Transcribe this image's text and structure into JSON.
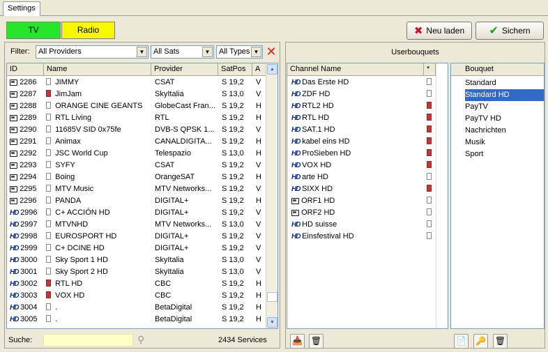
{
  "tabs": [
    {
      "label": "Settings"
    }
  ],
  "mode": {
    "tv_label": "TV",
    "radio_label": "Radio",
    "tv_color": "#27e627",
    "radio_color": "#f7f700"
  },
  "actions": {
    "reload_label": "Neu laden",
    "save_label": "Sichern"
  },
  "filter": {
    "label": "Filter:",
    "providers": "All Providers",
    "sats": "All Sats",
    "types": "All Types"
  },
  "services": {
    "columns": [
      "ID",
      "Name",
      "Provider",
      "SatPos",
      "A"
    ],
    "rows": [
      {
        "icon": "tv",
        "doc": "white",
        "id": "2286",
        "name": "JIMMY",
        "provider": "CSAT",
        "satpos": "S 19,2",
        "a": "V"
      },
      {
        "icon": "tv",
        "doc": "red",
        "id": "2287",
        "name": "JimJam",
        "provider": "SkyItalia",
        "satpos": "S 13,0",
        "a": "V"
      },
      {
        "icon": "tv",
        "doc": "white",
        "id": "2288",
        "name": "ORANGE CINE GEANTS",
        "provider": "GlobeCast Fran...",
        "satpos": "S 19,2",
        "a": "H"
      },
      {
        "icon": "tv",
        "doc": "white",
        "id": "2289",
        "name": "RTL Living",
        "provider": "RTL",
        "satpos": "S 19,2",
        "a": "H"
      },
      {
        "icon": "tv",
        "doc": "white",
        "id": "2290",
        "name": "11685V SID 0x75fe",
        "provider": "DVB-S QPSK 1...",
        "satpos": "S 19,2",
        "a": "V"
      },
      {
        "icon": "tv",
        "doc": "white",
        "id": "2291",
        "name": "Animax",
        "provider": "CANALDIGITA...",
        "satpos": "S 19,2",
        "a": "H"
      },
      {
        "icon": "tv",
        "doc": "white",
        "id": "2292",
        "name": "JSC World Cup",
        "provider": "Telespazio",
        "satpos": "S 13,0",
        "a": "H"
      },
      {
        "icon": "tv",
        "doc": "white",
        "id": "2293",
        "name": "SYFY",
        "provider": "CSAT",
        "satpos": "S 19,2",
        "a": "V"
      },
      {
        "icon": "tv",
        "doc": "white",
        "id": "2294",
        "name": "Boing",
        "provider": "OrangeSAT",
        "satpos": "S 19,2",
        "a": "H"
      },
      {
        "icon": "tv",
        "doc": "white",
        "id": "2295",
        "name": "MTV Music",
        "provider": "MTV Networks...",
        "satpos": "S 19,2",
        "a": "V"
      },
      {
        "icon": "tv",
        "doc": "white",
        "id": "2296",
        "name": "PANDA",
        "provider": "DIGITAL+",
        "satpos": "S 19,2",
        "a": "H"
      },
      {
        "icon": "hd",
        "doc": "white",
        "id": "2996",
        "name": "C+ ACCIÓN HD",
        "provider": "DIGITAL+",
        "satpos": "S 19,2",
        "a": "V"
      },
      {
        "icon": "hd",
        "doc": "white",
        "id": "2997",
        "name": "MTVNHD",
        "provider": "MTV Networks...",
        "satpos": "S 13,0",
        "a": "V"
      },
      {
        "icon": "hd",
        "doc": "white",
        "id": "2998",
        "name": "EUROSPORT HD",
        "provider": "DIGITAL+",
        "satpos": "S 19,2",
        "a": "V"
      },
      {
        "icon": "hd",
        "doc": "white",
        "id": "2999",
        "name": "C+ DCINE HD",
        "provider": "DIGITAL+",
        "satpos": "S 19,2",
        "a": "V"
      },
      {
        "icon": "hd",
        "doc": "white",
        "id": "3000",
        "name": "Sky Sport 1 HD",
        "provider": "SkyItalia",
        "satpos": "S 13,0",
        "a": "V"
      },
      {
        "icon": "hd",
        "doc": "white",
        "id": "3001",
        "name": "Sky Sport 2 HD",
        "provider": "SkyItalia",
        "satpos": "S 13,0",
        "a": "V"
      },
      {
        "icon": "hd",
        "doc": "red",
        "id": "3002",
        "name": "RTL HD",
        "provider": "CBC",
        "satpos": "S 19,2",
        "a": "H"
      },
      {
        "icon": "hd",
        "doc": "red",
        "id": "3003",
        "name": "VOX HD",
        "provider": "CBC",
        "satpos": "S 19,2",
        "a": "H"
      },
      {
        "icon": "hd",
        "doc": "white",
        "id": "3004",
        "name": ".",
        "provider": "BetaDigital",
        "satpos": "S 19,2",
        "a": "H"
      },
      {
        "icon": "hd",
        "doc": "white",
        "id": "3005",
        "name": ".",
        "provider": "BetaDigital",
        "satpos": "S 19,2",
        "a": "H"
      }
    ]
  },
  "search": {
    "label": "Suche:",
    "value": "",
    "count": "2434 Services"
  },
  "userbouquets": {
    "title": "Userbouquets",
    "columns": [
      "Channel Name",
      "*"
    ],
    "channels": [
      {
        "icon": "hd",
        "name": "Das Erste HD",
        "doc": "white"
      },
      {
        "icon": "hd",
        "name": "ZDF HD",
        "doc": "white"
      },
      {
        "icon": "hd",
        "name": "RTL2 HD",
        "doc": "red"
      },
      {
        "icon": "hd",
        "name": "RTL HD",
        "doc": "red"
      },
      {
        "icon": "hd",
        "name": "SAT.1 HD",
        "doc": "red"
      },
      {
        "icon": "hd",
        "name": "kabel eins HD",
        "doc": "red"
      },
      {
        "icon": "hd",
        "name": "ProSieben HD",
        "doc": "red"
      },
      {
        "icon": "hd",
        "name": "VOX HD",
        "doc": "red"
      },
      {
        "icon": "hd",
        "name": "arte HD",
        "doc": "white"
      },
      {
        "icon": "hd",
        "name": "SIXX HD",
        "doc": "red"
      },
      {
        "icon": "tv",
        "name": "ORF1 HD",
        "doc": "white"
      },
      {
        "icon": "tv",
        "name": "ORF2 HD",
        "doc": "white"
      },
      {
        "icon": "hd",
        "name": "HD suisse",
        "doc": "white"
      },
      {
        "icon": "hd",
        "name": "Einsfestival HD",
        "doc": "white"
      }
    ],
    "bouquet_header": "Bouquet",
    "bouquets": [
      "Standard",
      "Standard HD",
      "PayTV",
      "PayTV HD",
      "Nachrichten",
      "Musik",
      "Sport"
    ],
    "selected_bouquet": 1
  }
}
